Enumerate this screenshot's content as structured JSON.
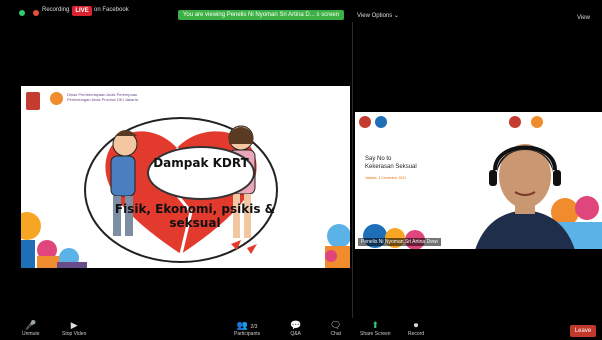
{
  "topbar": {
    "recording_label": "Recording",
    "live_badge": "LIVE",
    "live_platform": "on Facebook",
    "viewing_banner": "You are viewing Penelis Ni Nyoman Sri Artina D... s screen",
    "view_options": "View Options ⌄",
    "view_right": "View"
  },
  "slide": {
    "org_text": "Dinas Pemberdayaan Anak Perempuan Perlindungan Anak Provinsi DKI Jakarta",
    "title": "Dampak KDRT",
    "caption": "Fisik, Ekonomi, psikis & seksual"
  },
  "panel": {
    "title_line1": "Say No to",
    "title_line2": "Kekerasan Seksual",
    "subtitle": "Jakarta, 3 Desember 2021",
    "participant_name": "Penelis Ni Nyoman Sri Artina Dewi"
  },
  "toolbar": {
    "unmute": "Unmute",
    "stop_video": "Stop Video",
    "participants": "Participants",
    "participants_count": "2/3",
    "qa": "Q&A",
    "chat": "Chat",
    "share_screen": "Share Screen",
    "record": "Record",
    "leave": "Leave"
  },
  "colors": {
    "live_red": "#d9232e",
    "banner_green": "#3cb043",
    "share_green": "#2ecc71",
    "leave_red": "#c0392b"
  }
}
